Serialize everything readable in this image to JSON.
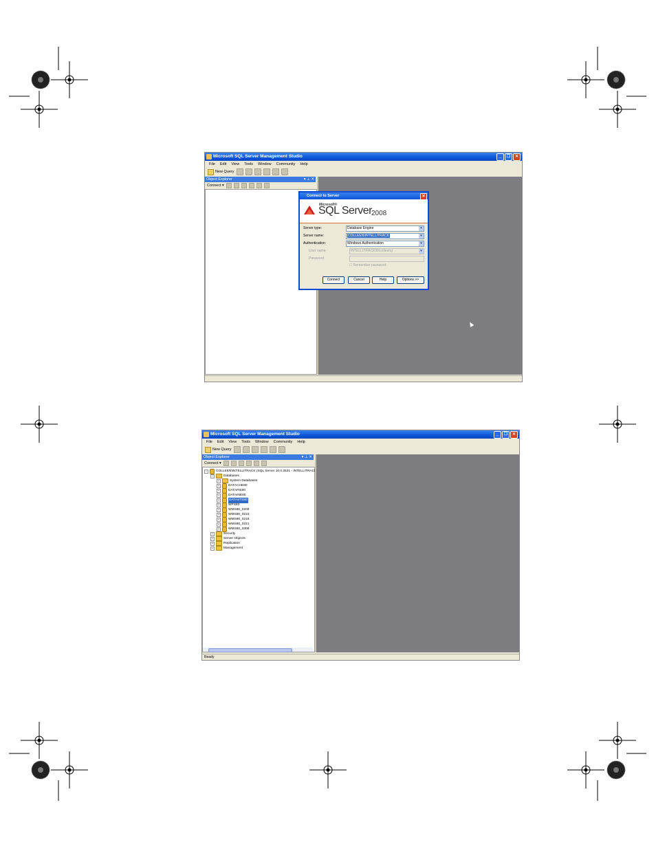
{
  "screen1": {
    "title": "Microsoft SQL Server Management Studio",
    "menu": [
      "File",
      "Edit",
      "View",
      "Tools",
      "Window",
      "Community",
      "Help"
    ],
    "toolbar_new_query": "New Query",
    "object_explorer": "Object Explorer",
    "connect_label": "Connect ▾",
    "dialog": {
      "title": "Connect to Server",
      "brand_microsoft": "Microsoft®",
      "brand_sql": "SQL Server",
      "brand_year": "2008",
      "server_type_label": "Server type:",
      "server_type_value": "Database Engine",
      "server_name_label": "Server name:",
      "server_name_value": "COLLEEN\\INTELLITRACK",
      "auth_label": "Authentication:",
      "auth_value": "Windows Authentication",
      "user_label": "User name:",
      "user_value": "INTELLITRACK06\\colleeng",
      "password_label": "Password:",
      "remember_label": "Remember password",
      "buttons": [
        "Connect",
        "Cancel",
        "Help",
        "Options >>"
      ]
    }
  },
  "screen2": {
    "title": "Microsoft SQL Server Management Studio",
    "menu": [
      "File",
      "Edit",
      "View",
      "Tools",
      "Window",
      "Community",
      "Help"
    ],
    "toolbar_new_query": "New Query",
    "object_explorer": "Object Explorer",
    "connect_label": "Connect ▾",
    "server_node": "COLLEEN\\INTELLITRACK (SQL Server 10.0.2531 - INTELLITRACK",
    "databases_label": "Databases",
    "databases": [
      "System Databases",
      "DATACHE80",
      "DATAFIE80",
      "DATAINE80",
      "DATASTE80",
      "WPS80",
      "WMS80_0209",
      "WMS80_0210",
      "WMS80_0216",
      "WMS80_0221",
      "WMS80_0308"
    ],
    "selected_database": "DATASTE80",
    "folders": [
      "Security",
      "Server Objects",
      "Replication",
      "Management"
    ],
    "status": "Ready"
  }
}
